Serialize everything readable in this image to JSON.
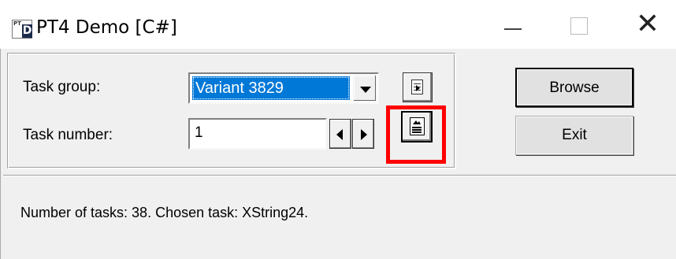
{
  "window": {
    "title": "PT4 Demo [C#]",
    "icon": "pt4-app-icon",
    "icon_text_small": "PT",
    "icon_text_large": "D"
  },
  "controls": {
    "task_group_label": "Task group:",
    "task_group_value": "Variant 3829",
    "task_number_label": "Task number:",
    "task_number_value": "1",
    "select_group_icon": "select-list-icon",
    "show_task_icon": "task-document-icon"
  },
  "buttons": {
    "browse": "Browse",
    "exit": "Exit"
  },
  "status": {
    "text": "Number of tasks: 38.   Chosen task: XString24."
  },
  "colors": {
    "selection": "#0078d7",
    "highlight": "#ff0000",
    "client_bg": "#f0f0f0"
  }
}
